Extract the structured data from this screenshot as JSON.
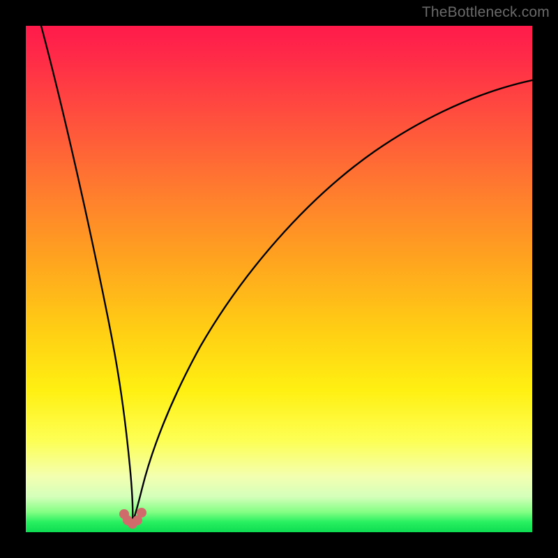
{
  "watermark": "TheBottleneck.com",
  "colors": {
    "frame": "#000000",
    "gradient_top": "#ff1a4b",
    "gradient_mid": "#ffe313",
    "gradient_bottom": "#0edc52",
    "curve": "#000000",
    "dots": "#cf6b6b"
  },
  "chart_data": {
    "type": "line",
    "title": "",
    "xlabel": "",
    "ylabel": "",
    "xlim": [
      0,
      100
    ],
    "ylim": [
      0,
      100
    ],
    "grid": false,
    "legend": false,
    "note": "x is horizontal position (0=left,100=right); y is vertical (0=bottom,100=top). Values estimated from pixel positions.",
    "series": [
      {
        "name": "left-branch",
        "x": [
          3,
          6,
          9,
          12,
          14,
          16,
          17.5,
          18.8,
          19.6,
          20.2
        ],
        "y": [
          100,
          80,
          61,
          44,
          31,
          20,
          12,
          6.5,
          3.5,
          2.0
        ]
      },
      {
        "name": "right-branch",
        "x": [
          22.2,
          23.2,
          25,
          28,
          32,
          38,
          45,
          55,
          66,
          78,
          90,
          100
        ],
        "y": [
          2.2,
          4.0,
          8,
          16,
          26,
          38,
          49,
          61,
          71,
          79,
          85,
          89
        ]
      }
    ],
    "markers": [
      {
        "name": "valley-dot-left-upper",
        "x": 19.4,
        "y": 3.6
      },
      {
        "name": "valley-dot-left-lower",
        "x": 20.0,
        "y": 2.4
      },
      {
        "name": "valley-dot-center",
        "x": 21.1,
        "y": 1.6
      },
      {
        "name": "valley-dot-right-lower",
        "x": 22.1,
        "y": 2.4
      },
      {
        "name": "valley-dot-right-upper",
        "x": 22.9,
        "y": 4.0
      }
    ]
  }
}
